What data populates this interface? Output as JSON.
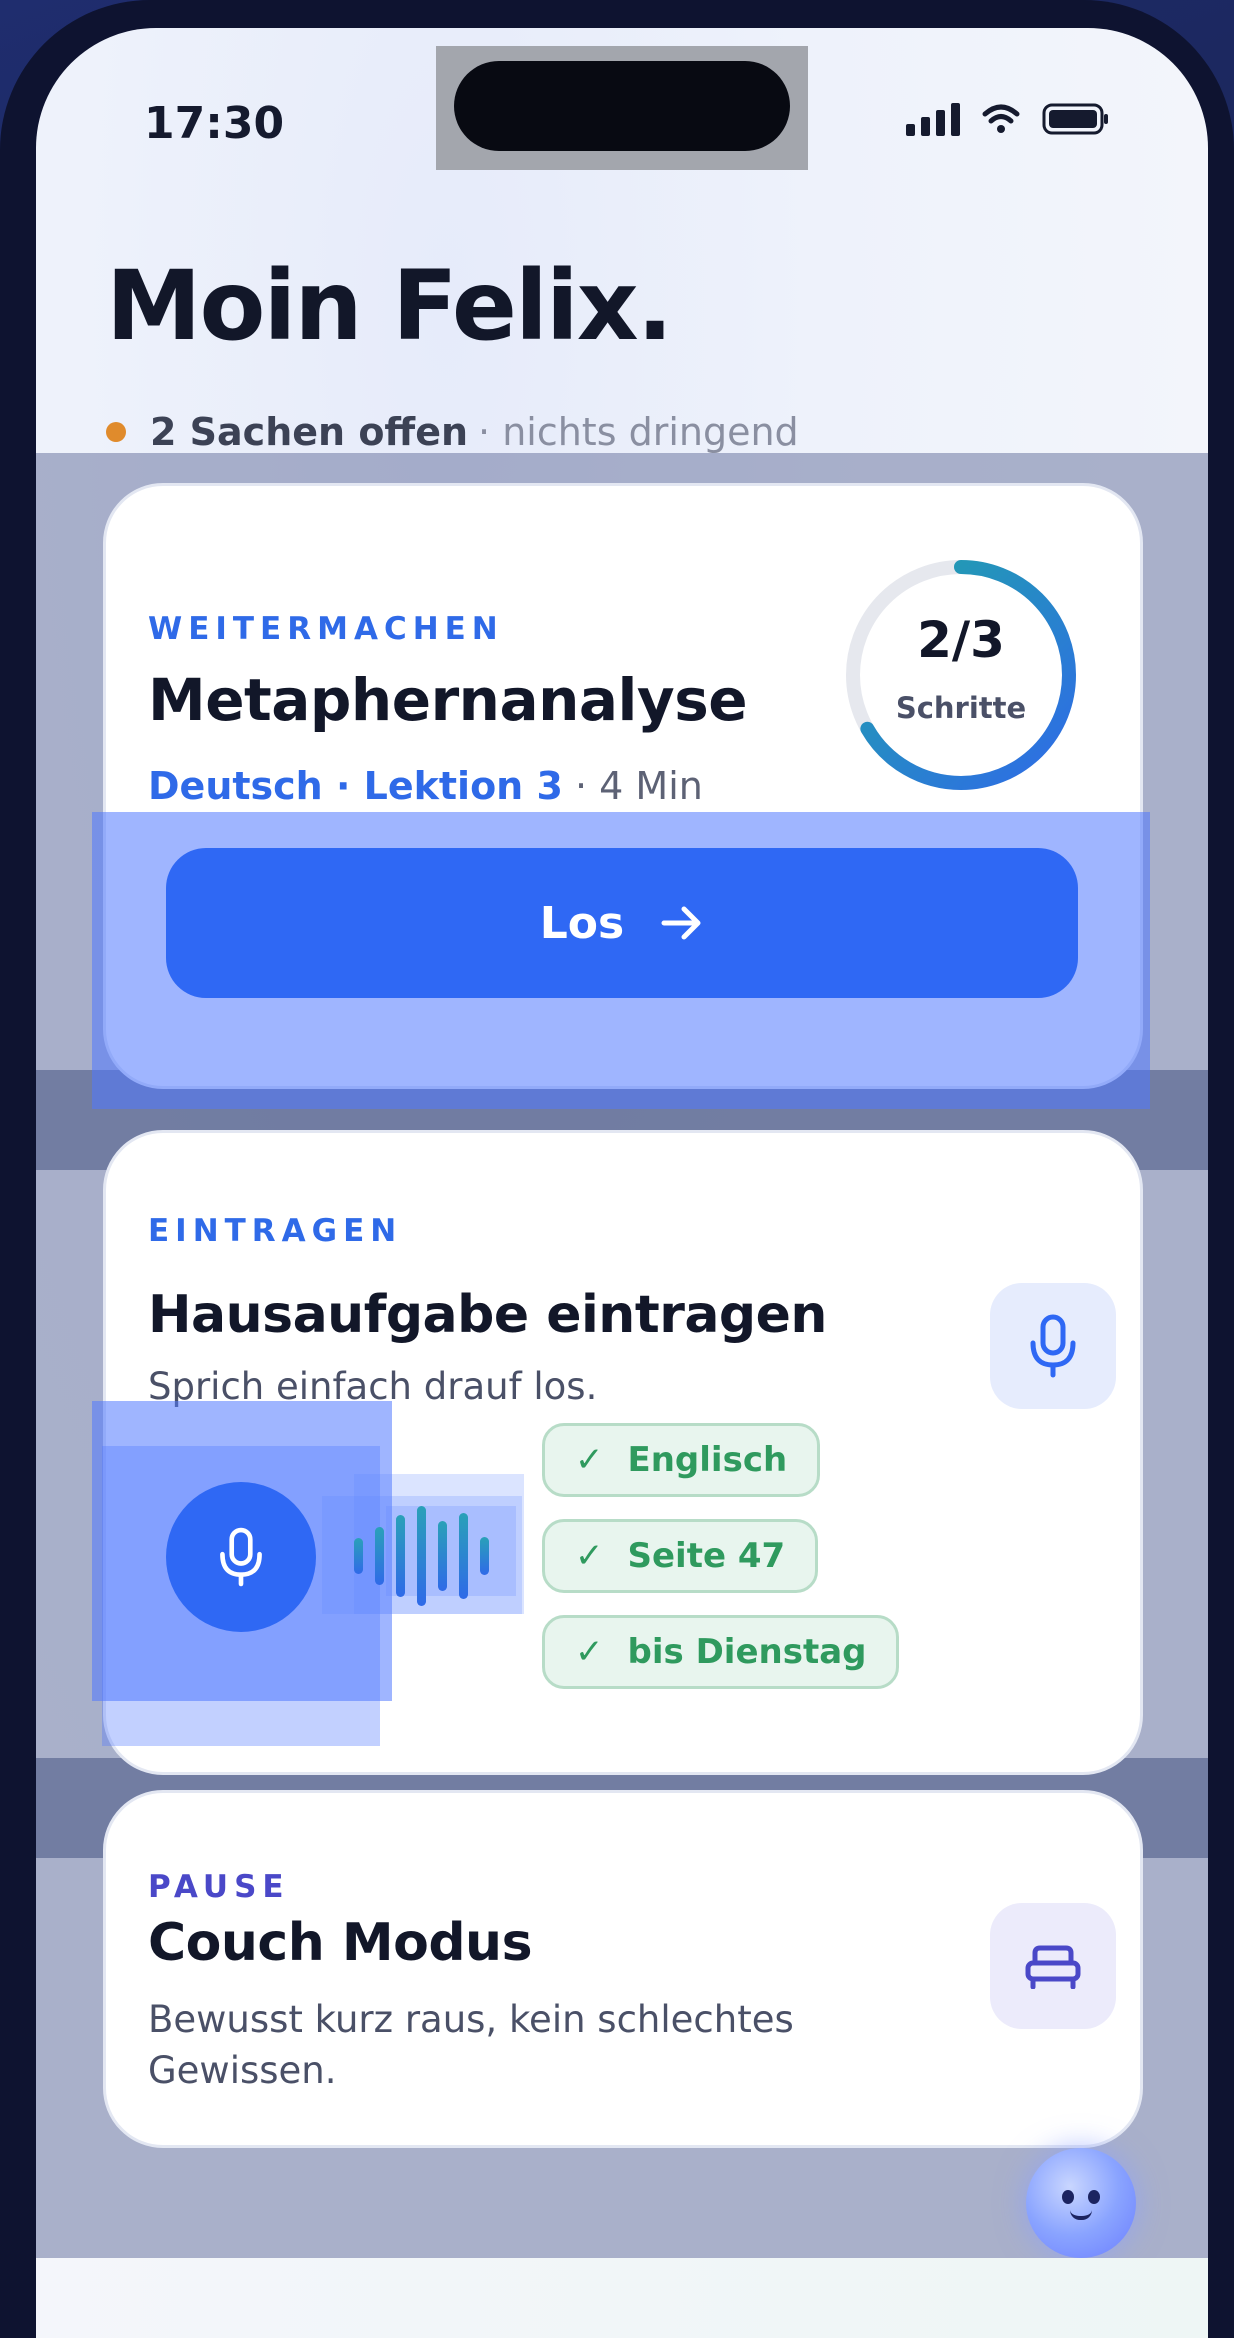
{
  "status_bar": {
    "time": "17:30",
    "signal_icon": "cellular-signal-icon",
    "wifi_icon": "wifi-icon",
    "battery_icon": "battery-icon"
  },
  "header": {
    "greeting": "Moin Felix.",
    "open_count": "2 Sachen offen",
    "open_note": "· nichts dringend",
    "indicator_color": "#e08b2c"
  },
  "continue_card": {
    "kicker": "WEITERMACHEN",
    "title": "Metaphernanalyse",
    "subject": "Deutsch · Lektion 3",
    "duration": "· 4 Min",
    "progress_label": "2/3",
    "progress_caption": "Schritte",
    "progress_fraction": 0.6667,
    "button_label": "Los",
    "button_icon": "arrow-right-icon",
    "accent": "#2f68f4"
  },
  "entry_card": {
    "kicker": "EINTRAGEN",
    "title": "Hausaufgabe eintragen",
    "description": "Sprich einfach drauf los.",
    "icon": "microphone-icon",
    "chips": [
      {
        "label": "Englisch",
        "check": "✓"
      },
      {
        "label": "Seite 47",
        "check": "✓"
      },
      {
        "label": "bis Dienstag",
        "check": "✓"
      }
    ],
    "chip_color": "#2f9a5e"
  },
  "pause_card": {
    "kicker": "PAUSE",
    "title": "Couch Modus",
    "description_line1": "Bewusst kurz raus, kein schlechtes",
    "description_line2": "Gewissen.",
    "icon": "couch-icon",
    "accent": "#4a48c8"
  },
  "assistant": {
    "icon": "brain-mascot-icon"
  }
}
